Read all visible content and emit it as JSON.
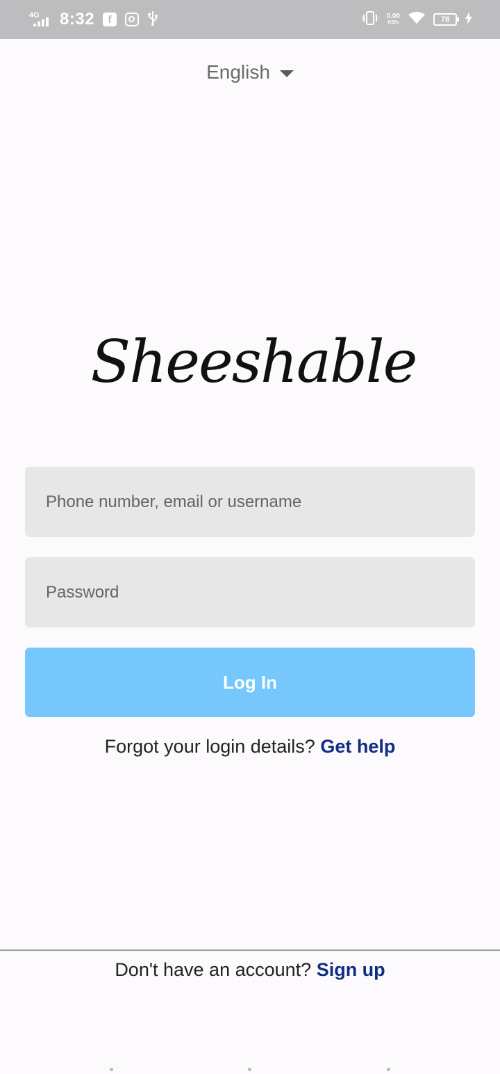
{
  "status_bar": {
    "network": "4G",
    "time": "8:32",
    "speed_value": "0.00",
    "speed_unit": "KB/s",
    "battery": "78",
    "icons": [
      "facebook-icon",
      "instagram-icon",
      "usb-icon",
      "vibrate-icon",
      "wifi-icon",
      "battery-icon",
      "charging-icon"
    ]
  },
  "language": {
    "selected": "English"
  },
  "logo": {
    "text": "Sheeshable"
  },
  "form": {
    "username_placeholder": "Phone number, email or username",
    "username_value": "",
    "password_placeholder": "Password",
    "password_value": "",
    "login_label": "Log In"
  },
  "help": {
    "prompt": "Forgot your login details?",
    "link": "Get help"
  },
  "signup": {
    "prompt": "Don't have an account?",
    "link": "Sign up"
  },
  "colors": {
    "background": "#fdfafd",
    "status_bar": "#bdbcbf",
    "field": "#e7e7e7",
    "button": "#76c7fb",
    "link": "#0e2e85"
  }
}
